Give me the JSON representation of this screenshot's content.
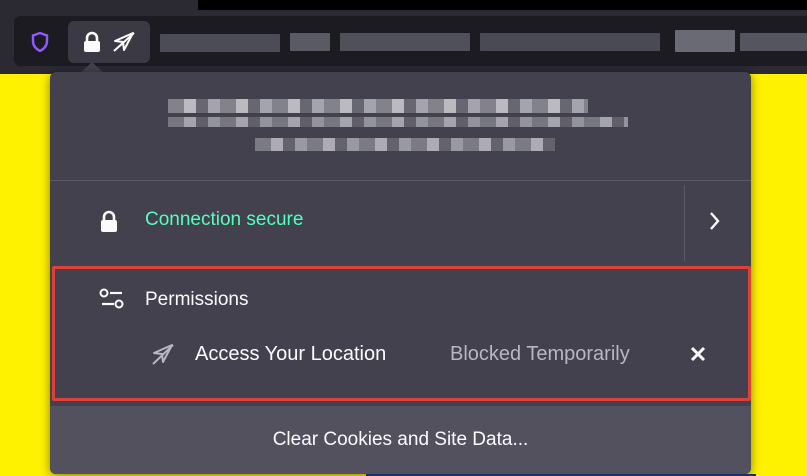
{
  "colors": {
    "background": "#FFF200",
    "panel": "#42414D",
    "accent_secure": "#54FFBD",
    "highlight_border": "#E0403A",
    "shield": "#9059FF"
  },
  "toolbar": {
    "tracking_icon": "shield-icon",
    "identity_icons": [
      "lock-icon",
      "location-blocked-icon"
    ]
  },
  "panel": {
    "connection": {
      "label": "Connection secure",
      "icon": "lock-icon",
      "chevron": "chevron-right-icon"
    },
    "permissions": {
      "title": "Permissions",
      "icon": "permissions-icon",
      "items": [
        {
          "label": "Access Your Location",
          "state": "Blocked Temporarily",
          "icon": "location-blocked-icon",
          "clear": "×"
        }
      ]
    },
    "footer": {
      "button_label": "Clear Cookies and Site Data..."
    }
  }
}
